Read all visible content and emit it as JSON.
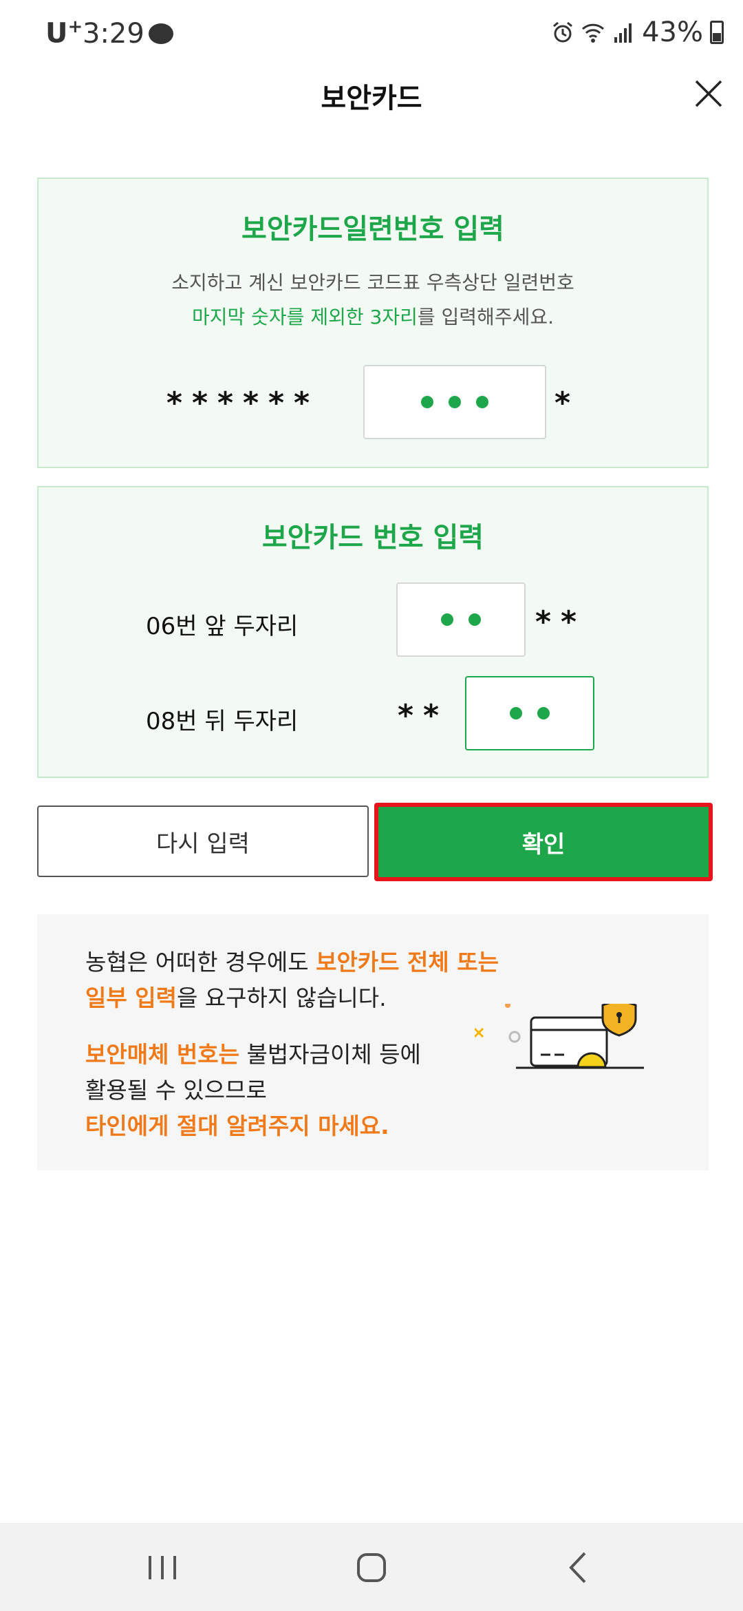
{
  "status_bar": {
    "carrier": "U",
    "carrier_sup": "+",
    "time": "3:29",
    "battery": "43%"
  },
  "header": {
    "title": "보안카드"
  },
  "serial_panel": {
    "title": "보안카드일련번호 입력",
    "desc_line1": "소지하고 계신 보안카드 코드표 우측상단 일련번호",
    "desc_line2_green": "마지막 숫자를 제외한 3자리",
    "desc_line2_rest": "를 입력해주세요.",
    "masked_prefix": "******",
    "masked_suffix": "*"
  },
  "number_panel": {
    "title": "보안카드 번호 입력",
    "row1_label": "06번 앞 두자리",
    "row1_suffix": "**",
    "row2_label": "08번 뒤 두자리",
    "row2_prefix": "**"
  },
  "buttons": {
    "retry": "다시 입력",
    "confirm": "확인"
  },
  "notice": {
    "line1_plain": "농협은 어떠한 경우에도 ",
    "line1_orange": "보안카드 전체 또는",
    "line2_orange": "일부 입력",
    "line2_plain": "을 요구하지 않습니다.",
    "line3_orange": "보안매체 번호는",
    "line3_plain": " 불법자금이체 등에",
    "line4_plain": "활용될 수 있으므로",
    "line5_orange": "타인에게 절대 알려주지 마세요."
  },
  "colors": {
    "green": "#1ea64a",
    "orange": "#f07a1a",
    "highlight": "#e8141b"
  }
}
